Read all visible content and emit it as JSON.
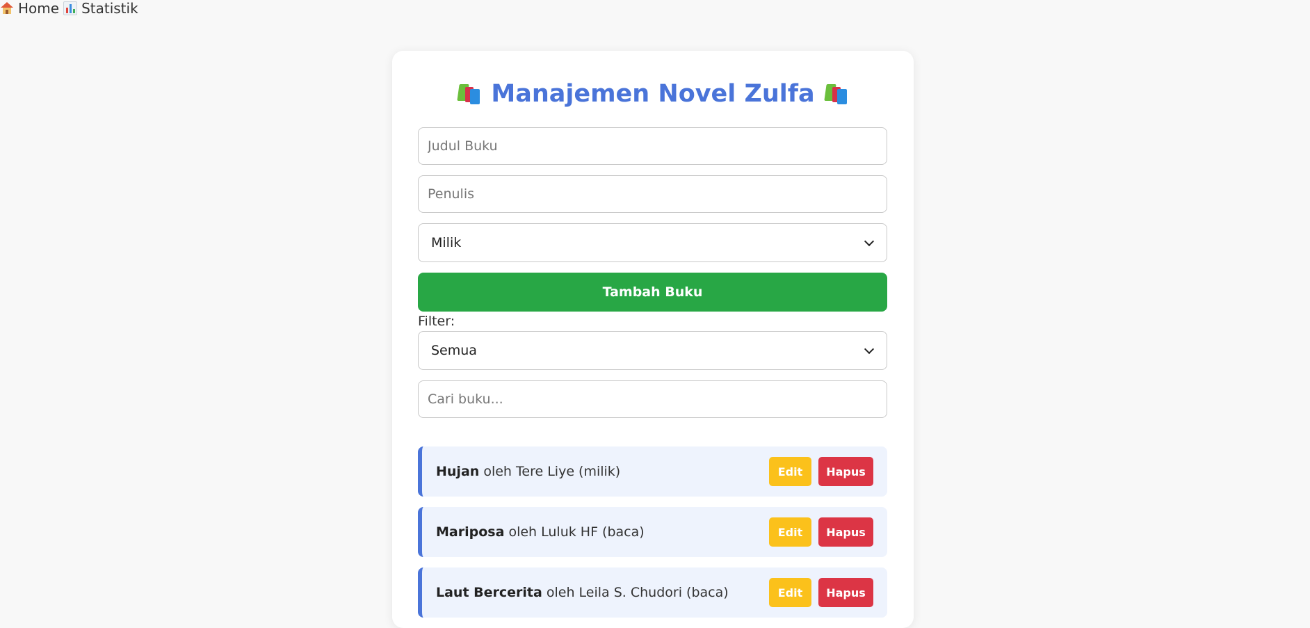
{
  "nav": {
    "home_label": "Home",
    "stats_label": "Statistik",
    "home_icon": "house-icon",
    "stats_icon": "bar-chart-icon"
  },
  "app": {
    "title": "Manajemen Novel Zulfa",
    "title_icon": "books-icon",
    "title_color": "#4a74d9"
  },
  "form": {
    "title_placeholder": "Judul Buku",
    "title_value": "",
    "author_placeholder": "Penulis",
    "author_value": "",
    "status_selected": "Milik",
    "add_button_label": "Tambah Buku",
    "add_button_color": "#28a745"
  },
  "filter": {
    "label": "Filter:",
    "selected": "Semua",
    "search_placeholder": "Cari buku...",
    "search_value": ""
  },
  "books": [
    {
      "title": "Hujan",
      "details": "oleh Tere Liye (milik)",
      "edit_label": "Edit",
      "delete_label": "Hapus"
    },
    {
      "title": "Mariposa",
      "details": "oleh Luluk HF (baca)",
      "edit_label": "Edit",
      "delete_label": "Hapus"
    },
    {
      "title": "Laut Bercerita",
      "details": "oleh Leila S. Chudori (baca)",
      "edit_label": "Edit",
      "delete_label": "Hapus"
    }
  ],
  "colors": {
    "edit": "#fbc11b",
    "delete": "#dc3545",
    "item_background": "#eef3fd",
    "item_accent": "#4a74d9"
  }
}
